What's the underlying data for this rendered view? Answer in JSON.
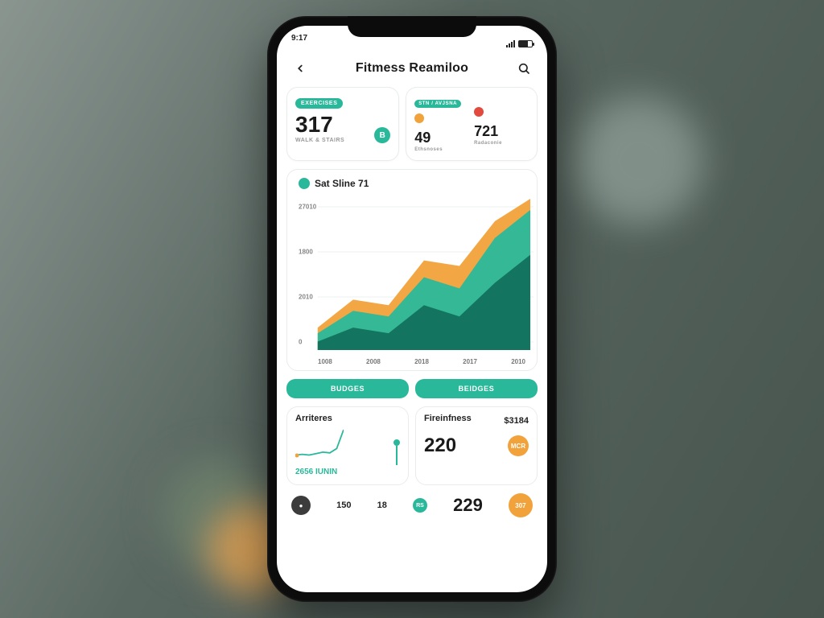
{
  "statusbar": {
    "time": "9:17"
  },
  "header": {
    "title": "Fitmess Reamiloo"
  },
  "stats": {
    "left": {
      "pill": "EXERCISES",
      "value": "317",
      "sub": "WALK & STAIRS",
      "badge": "B"
    },
    "right": {
      "pill": "STN / AVJSNA",
      "a_val": "49",
      "a_sub": "Ethsnoses",
      "b_val": "721",
      "b_sub": "Radaconie"
    }
  },
  "chart": {
    "title": "Sat Sline 71"
  },
  "chart_data": {
    "type": "area",
    "title": "Sat Sline 71",
    "xlabel": "",
    "ylabel": "",
    "ylim": [
      0,
      2700
    ],
    "y_ticks": [
      "27010",
      "1800",
      "2010",
      "0"
    ],
    "categories": [
      "1008",
      "2008",
      "2018",
      "2017",
      "2010"
    ],
    "series": [
      {
        "name": "series-orange",
        "color": "#f2a23a",
        "values": [
          400,
          900,
          800,
          1600,
          1500,
          2300,
          2700
        ]
      },
      {
        "name": "series-teal",
        "color": "#2ab89a",
        "values": [
          300,
          700,
          600,
          1300,
          1100,
          2000,
          2500
        ]
      },
      {
        "name": "series-dark",
        "color": "#0f6e59",
        "values": [
          150,
          400,
          300,
          800,
          600,
          1200,
          1700
        ]
      }
    ]
  },
  "buttons": {
    "left": "BUDGES",
    "right": "BEIDGES"
  },
  "bottom": {
    "left": {
      "header": "Arriteres",
      "sub": "2656 IUNIN",
      "spark": [
        5,
        6,
        5,
        7,
        9,
        8,
        14,
        40
      ]
    },
    "right": {
      "header": "Fireinfness",
      "side": "$3184",
      "value": "220",
      "badge": "MCR"
    }
  },
  "footer": {
    "dot": "●",
    "a": "150",
    "b": "18",
    "chip": "RS",
    "big": "229",
    "badge": "307"
  }
}
